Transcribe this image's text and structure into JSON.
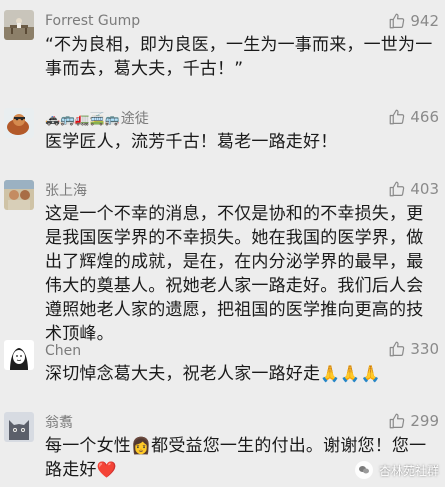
{
  "comments": [
    {
      "user": "Forrest Gump",
      "likes": "942",
      "text": "“不为良相，即为良医，一生为一事而来，一世为一事而去，葛大夫，千古！”"
    },
    {
      "user": "途徒",
      "user_prefix": "🚓🚌🚛🚎🚌",
      "likes": "466",
      "text": "医学匠人，流芳千古！葛老一路走好！"
    },
    {
      "user": "张上海",
      "likes": "403",
      "text": "这是一个不幸的消息，不仅是协和的不幸损失，更是我国医学界的不幸损失。她在我国的医学界，做出了辉煌的成就，是在，在内分泌学界的最早，最伟大的奠基人。祝她老人家一路走好。我们后人会遵照她老人家的遗愿，把祖国的医学推向更高的技术顶峰。"
    },
    {
      "user": "Chen",
      "likes": "330",
      "text": "深切悼念葛大夫，祝老人家一路好走",
      "emoji": "🙏🙏🙏"
    },
    {
      "user": "翁翥",
      "likes": "299",
      "text_before": "每一个女性",
      "emoji_mid": "👩",
      "text_after": "都受益您一生的付出。谢谢您！您一路走好",
      "emoji_end": "❤️"
    }
  ],
  "watermark": {
    "label": "杏林苑社群"
  },
  "icons": {
    "like": "thumbs-up-icon",
    "watermark": "wechat-icon"
  },
  "colors": {
    "background": "#ededed",
    "name": "#7b7b7b",
    "text": "#1a1a1a",
    "likes": "#8a8a8a"
  }
}
